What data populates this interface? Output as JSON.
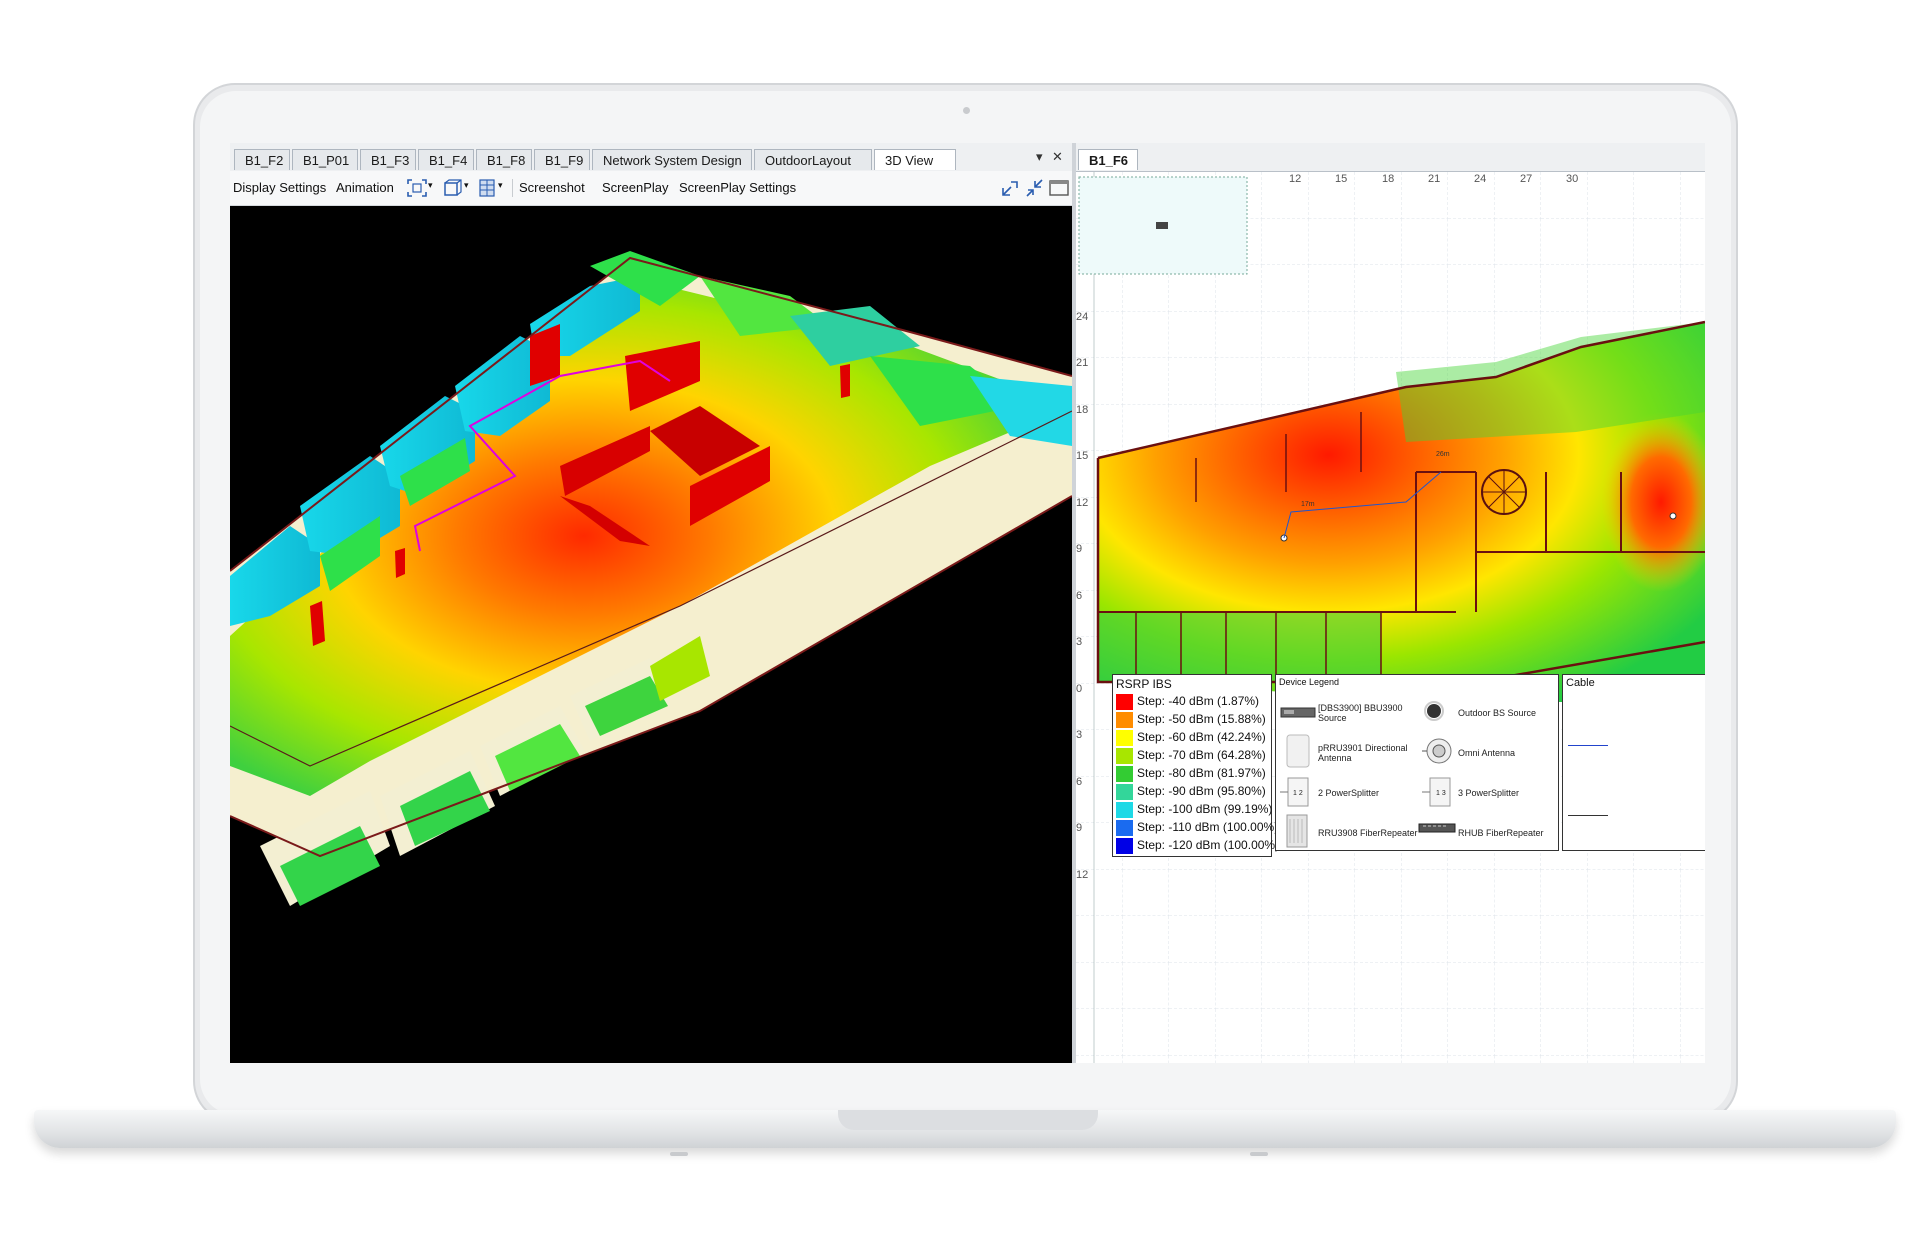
{
  "left_tabs": [
    "B1_F2",
    "B1_P01",
    "B1_F3",
    "B1_F4",
    "B1_F8",
    "B1_F9",
    "Network System Design",
    "OutdoorLayout",
    "3D View"
  ],
  "active_left_tab": "3D View",
  "left_tab_controls": {
    "dropdown": "▾",
    "close": "✕"
  },
  "toolbar": {
    "display_settings": "Display Settings",
    "animation": "Animation",
    "screenshot": "Screenshot",
    "screenplay": "ScreenPlay",
    "screenplay_settings": "ScreenPlay Settings"
  },
  "right_tab": "B1_F6",
  "x_ticks": [
    "12",
    "15",
    "18",
    "21",
    "24",
    "27",
    "30"
  ],
  "y_ticks": [
    "24",
    "21",
    "18",
    "15",
    "12",
    "9",
    "6",
    "3",
    "0",
    "3",
    "6",
    "9",
    "12"
  ],
  "plan_labels": {
    "label_a": "26m",
    "label_b": "17m"
  },
  "rsrp_legend": {
    "title": "RSRP IBS",
    "steps": [
      {
        "label": "Step: -40 dBm (1.87%)",
        "color": "#ff0000"
      },
      {
        "label": "Step: -50 dBm (15.88%)",
        "color": "#ff8c00"
      },
      {
        "label": "Step: -60 dBm (42.24%)",
        "color": "#ffff00"
      },
      {
        "label": "Step: -70 dBm (64.28%)",
        "color": "#a8e600"
      },
      {
        "label": "Step: -80 dBm (81.97%)",
        "color": "#33cc33"
      },
      {
        "label": "Step: -90 dBm (95.80%)",
        "color": "#33d69a"
      },
      {
        "label": "Step: -100 dBm (99.19%)",
        "color": "#1ed9e6"
      },
      {
        "label": "Step: -110 dBm (100.00%)",
        "color": "#1a6bf0"
      },
      {
        "label": "Step: -120 dBm (100.00%)",
        "color": "#0000e6"
      }
    ]
  },
  "device_legend": {
    "title": "Device Legend",
    "items": {
      "bbu": "[DBS3900] BBU3900 Source",
      "outdoor_bs": "Outdoor BS Source",
      "prru": "pRRU3901 Directional Antenna",
      "omni": "Omni Antenna",
      "ps2": "2 PowerSplitter",
      "ps3": "3 PowerSplitter",
      "rru": "RRU3908 FiberRepeater",
      "rhub": "RHUB FiberRepeater"
    },
    "ps2_mark": "1 2",
    "ps3_mark": "1 3"
  },
  "cable_legend": {
    "title": "Cable"
  }
}
